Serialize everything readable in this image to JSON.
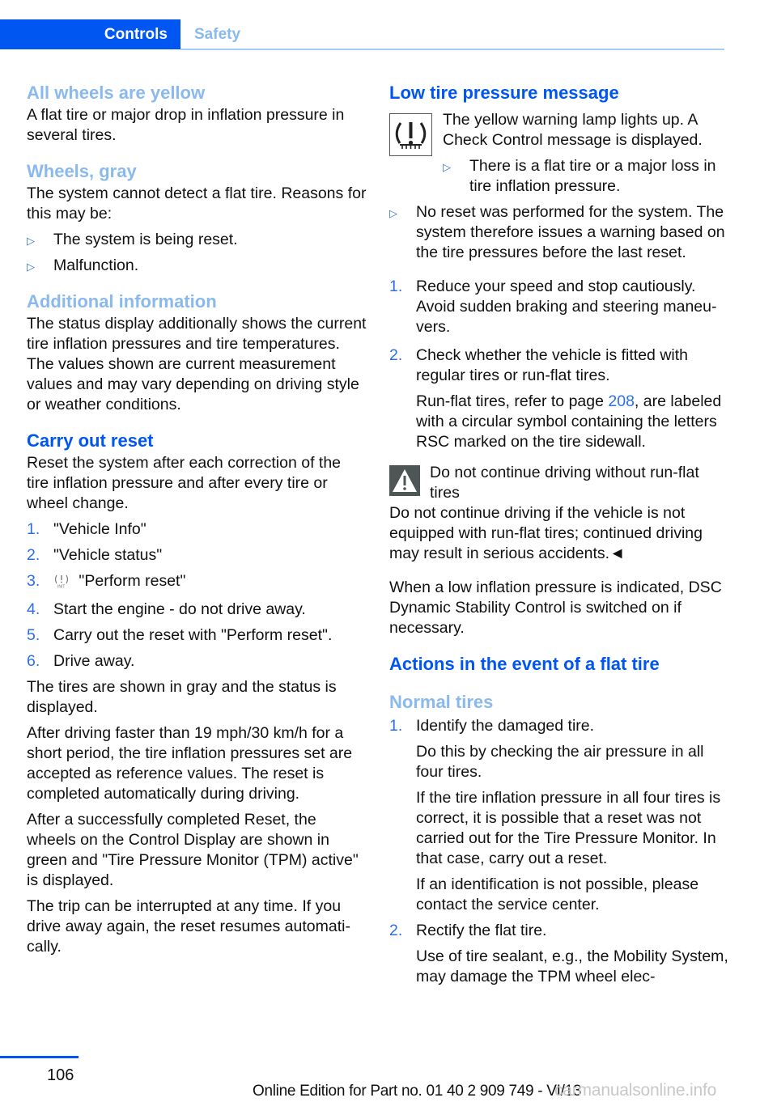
{
  "tabs": {
    "active": "Controls",
    "inactive": "Safety"
  },
  "left": {
    "sec1": {
      "heading": "All wheels are yellow",
      "body": "A flat tire or major drop in inflation pressure in several tires."
    },
    "sec2": {
      "heading": "Wheels, gray",
      "body": "The system cannot detect a flat tire. Reasons for this may be:",
      "bullets": [
        "The system is being reset.",
        "Malfunction."
      ]
    },
    "sec3": {
      "heading": "Additional information",
      "body": "The status display additionally shows the cur­rent tire inflation pressures and tire tempera­tures. The values shown are current measure­ment values and may vary depending on driving style or weather conditions."
    },
    "sec4": {
      "heading": "Carry out reset",
      "body": "Reset the system after each correction of the tire inflation pressure and after every tire or wheel change.",
      "steps": [
        {
          "num": "1.",
          "text": "\"Vehicle Info\""
        },
        {
          "num": "2.",
          "text": "\"Vehicle status\""
        },
        {
          "num": "3.",
          "text": "\"Perform reset\"",
          "icon": "tpm-init-icon"
        },
        {
          "num": "4.",
          "text": "Start the engine - do not drive away."
        },
        {
          "num": "5.",
          "text": "Carry out the reset with \"Perform reset\"."
        },
        {
          "num": "6.",
          "text": "Drive away."
        }
      ],
      "paras": [
        "The tires are shown in gray and the status is displayed.",
        "After driving faster than 19 mph/30 km/h for a short period, the tire inflation pressures set are accepted as reference values. The reset is completed automatically during driving.",
        "After a successfully completed Reset, the wheels on the Control Display are shown in green and \"Tire Pressure Monitor (TPM) active\" is displayed.",
        "The trip can be interrupted at any time. If you drive away again, the reset resumes automati­cally."
      ]
    }
  },
  "right": {
    "sec1": {
      "heading": "Low tire pressure message",
      "lamp_icon": "tire-pressure-warning-lamp-icon",
      "lamp_text": "The yellow warning lamp lights up. A Check Control message is displayed.",
      "sub_bullet": "There is a flat tire or a major loss in tire inflation pressure.",
      "bullet": "No reset was performed for the system. The system therefore issues a warning based on the tire pressures before the last reset.",
      "steps": [
        {
          "num": "1.",
          "text": "Reduce your speed and stop cautiously. Avoid sudden braking and steering maneu­vers."
        },
        {
          "num": "2.",
          "text": "Check whether the vehicle is fitted with regular tires or run-flat tires.",
          "sub_before": "Run-flat tires, refer to page ",
          "sub_link": "208",
          "sub_after": ", are la­beled with a circular symbol containing the letters RSC marked on the tire sidewall."
        }
      ],
      "warning_title": "Do not continue driving without run-flat tires",
      "warning_body": "Do not continue driving if the vehicle is not equipped with run-flat tires; continued driving may result in serious accidents.◄",
      "dsc_text": "When a low inflation pressure is indicated, DSC Dynamic Stability Control is switched on if necessary."
    },
    "sec2": {
      "heading": "Actions in the event of a flat tire",
      "subheading": "Normal tires",
      "steps": [
        {
          "num": "1.",
          "text": "Identify the damaged tire.",
          "subs": [
            "Do this by checking the air pressure in all four tires.",
            "If the tire inflation pressure in all four tires is correct, it is possible that a reset was not carried out for the Tire Pressure Monitor. In that case, carry out a reset.",
            "If an identification is not possible, please contact the service center."
          ]
        },
        {
          "num": "2.",
          "text": "Rectify the flat tire.",
          "subs": [
            "Use of tire sealant, e.g., the Mobility Sys­tem, may damage the TPM wheel elec-"
          ]
        }
      ]
    }
  },
  "footer": {
    "page_number": "106",
    "edition": "Online Edition for Part no. 01 40 2 909 749 - VI/13",
    "watermark": "carmanualsonline.info"
  },
  "colors": {
    "accent": "#0056f0",
    "heading_light": "#8ab9ee",
    "marker": "#2b6fe8"
  }
}
